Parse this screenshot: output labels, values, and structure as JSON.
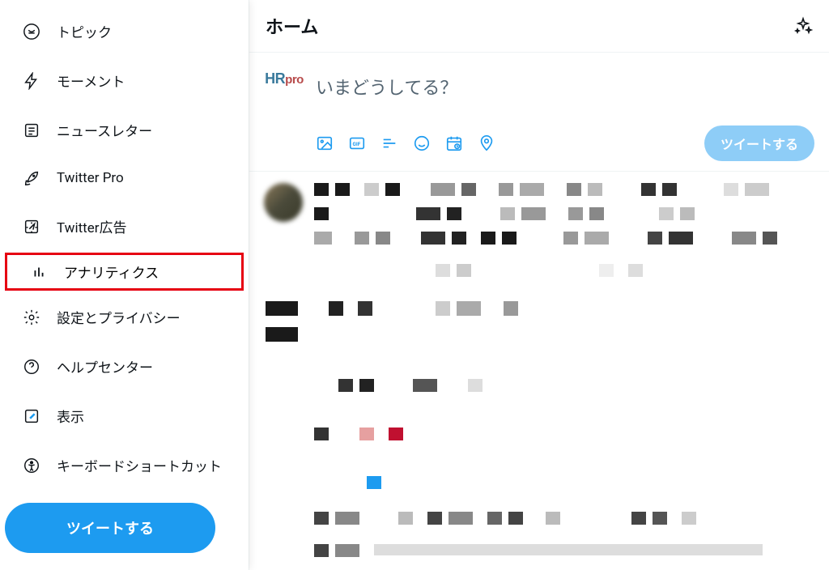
{
  "sidebar": {
    "items": [
      {
        "icon": "topics",
        "label": "トピック"
      },
      {
        "icon": "moments",
        "label": "モーメント"
      },
      {
        "icon": "newsletters",
        "label": "ニュースレター"
      },
      {
        "icon": "rocket",
        "label": "Twitter Pro"
      },
      {
        "icon": "ads",
        "label": "Twitter広告"
      },
      {
        "icon": "analytics",
        "label": "アナリティクス"
      },
      {
        "icon": "settings",
        "label": "設定とプライバシー"
      },
      {
        "icon": "help",
        "label": "ヘルプセンター"
      },
      {
        "icon": "display",
        "label": "表示"
      },
      {
        "icon": "keyboard",
        "label": "キーボードショートカット"
      }
    ],
    "tweet_button": "ツイートする"
  },
  "main": {
    "header_title": "ホーム",
    "compose": {
      "logo_hr": "HR",
      "logo_pro": "pro",
      "placeholder": "いまどうしてる？",
      "tweet_button": "ツイートする"
    }
  },
  "colors": {
    "primary": "#1d9bf0",
    "primary_disabled": "#8ecdf7",
    "text": "#0f1419",
    "text_secondary": "#536471",
    "highlight_border": "#e60012"
  }
}
